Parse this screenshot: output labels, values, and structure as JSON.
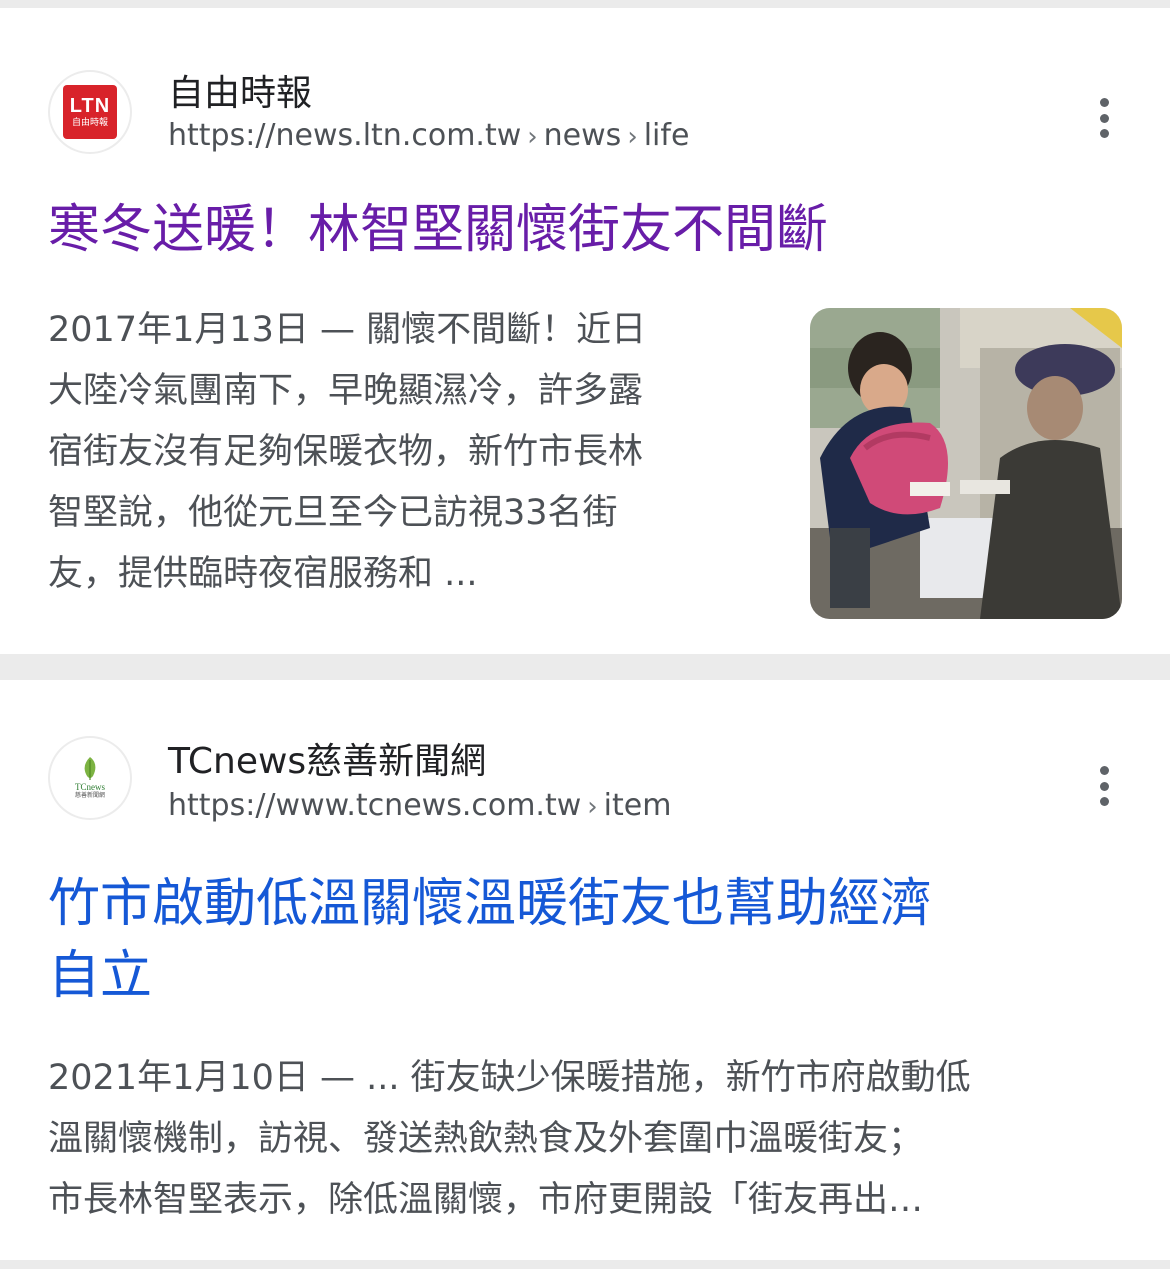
{
  "results": [
    {
      "site_name": "自由時報",
      "favicon_text": "LTN",
      "favicon_subtext": "自由時報",
      "url_base": "https://news.ltn.com.tw",
      "breadcrumbs": [
        "news",
        "life"
      ],
      "title_lines": [
        "寒冬送暖！林智堅關懷街友不間斷"
      ],
      "date": "2017年1月13日",
      "snippet_lines": [
        "2017年1月13日 — 關懷不間斷！近日",
        "大陸冷氣團南下，早晚顯濕冷，許多露",
        "宿街友沒有足夠保暖衣物，新竹市長林",
        "智堅說，他從元旦至今已訪視33名街",
        "友，提供臨時夜宿服務和 ..."
      ],
      "visited": true
    },
    {
      "site_name": "TCnews慈善新聞網",
      "favicon_text": "TCnews",
      "favicon_subtext": "慈善新聞網",
      "url_base": "https://www.tcnews.com.tw",
      "breadcrumbs": [
        "item"
      ],
      "title_lines": [
        "竹市啟動低溫關懷溫暖街友也幫助經濟",
        "自立"
      ],
      "date": "2021年1月10日",
      "snippet_lines": [
        "2021年1月10日 — ... 街友缺少保暖措施，新竹市府啟動低",
        "溫關懷機制，訪視、發送熱飲熱食及外套圍巾溫暖街友；",
        "市長林智堅表示，除低溫關懷，市府更開設「街友再出…"
      ],
      "visited": false
    }
  ],
  "colors": {
    "visited_link": "#681da8",
    "link": "#1558d6",
    "ltn_red": "#d8232a"
  },
  "icons": [
    "more-vert-icon",
    "chevron-right-icon"
  ]
}
